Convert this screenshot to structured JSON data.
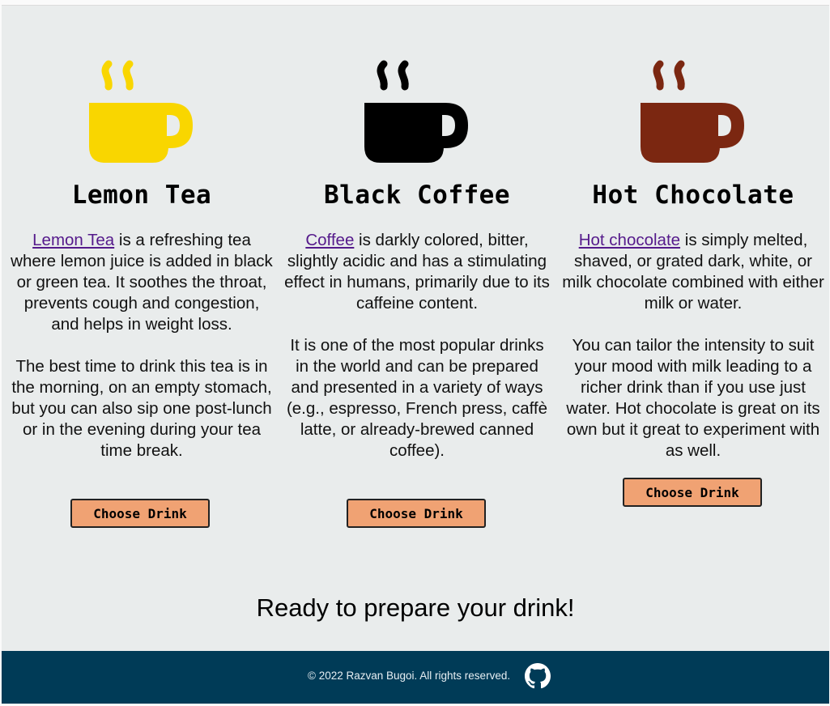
{
  "colors": {
    "lemon_cup": "#f9d600",
    "coffee_cup": "#000000",
    "chocolate_cup": "#7b2711",
    "button_bg": "#f0a273",
    "footer_bg": "#003b57",
    "link": "#551a8b"
  },
  "drinks": [
    {
      "icon": "coffee-cup-icon",
      "title": "Lemon Tea",
      "link_text": "Lemon Tea",
      "p1_rest": " is a refreshing tea where lemon juice is added in black or green tea. It soothes the throat, prevents cough and congestion, and helps in weight loss.",
      "p2": "The best time to drink this tea is in the morning, on an empty stomach, but you can also sip one post-lunch or in the evening during your tea time break.",
      "button": "Choose Drink"
    },
    {
      "icon": "coffee-cup-icon",
      "title": "Black Coffee",
      "link_text": "Coffee",
      "p1_rest": " is darkly colored, bitter, slightly acidic and has a stimulating effect in humans, primarily due to its caffeine content.",
      "p2": "It is one of the most popular drinks in the world and can be prepared and presented in a variety of ways (e.g., espresso, French press, caffè latte, or already-brewed canned coffee).",
      "button": "Choose Drink"
    },
    {
      "icon": "coffee-cup-icon",
      "title": "Hot Chocolate",
      "link_text": "Hot chocolate",
      "p1_rest": " is simply melted, shaved, or grated dark, white, or milk chocolate combined with either milk or water.",
      "p2": "You can tailor the intensity to suit your mood with milk leading to a richer drink than if you use just water. Hot chocolate is great on its own but it great to experiment with as well.",
      "button": "Choose Drink"
    }
  ],
  "ready_text": "Ready to prepare your drink!",
  "footer": {
    "copyright": "© 2022 Razvan Bugoi. All rights reserved.",
    "github_icon": "github-icon"
  }
}
